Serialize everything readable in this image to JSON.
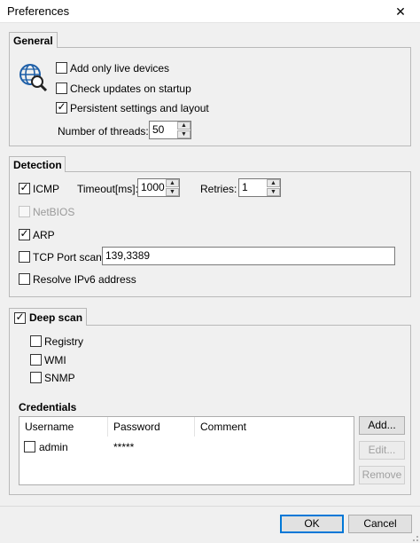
{
  "window": {
    "title": "Preferences",
    "close_glyph": "✕"
  },
  "general": {
    "tab_label": "General",
    "icon": "globe-search-icon",
    "options": [
      {
        "label": "Add only live devices",
        "checked": false
      },
      {
        "label": "Check updates on startup",
        "checked": false
      },
      {
        "label": "Persistent settings and layout",
        "checked": true
      }
    ],
    "threads_label": "Number of threads:",
    "threads_value": "50"
  },
  "detection": {
    "tab_label": "Detection",
    "icmp": {
      "label": "ICMP",
      "checked": true
    },
    "timeout_label": "Timeout[ms]:",
    "timeout_value": "1000",
    "retries_label": "Retries:",
    "retries_value": "1",
    "netbios": {
      "label": "NetBIOS",
      "checked": false,
      "disabled": true
    },
    "arp": {
      "label": "ARP",
      "checked": true
    },
    "tcp": {
      "label": "TCP Port scan",
      "checked": false
    },
    "tcp_ports": "139,3389",
    "ipv6": {
      "label": "Resolve IPv6 address",
      "checked": false
    }
  },
  "deep_scan": {
    "tab_label": "Deep scan",
    "checked": true,
    "registry": {
      "label": "Registry",
      "checked": false
    },
    "wmi": {
      "label": "WMI",
      "checked": false
    },
    "snmp": {
      "label": "SNMP",
      "checked": false
    },
    "credentials_label": "Credentials",
    "columns": [
      "Username",
      "Password",
      "Comment"
    ],
    "rows": [
      {
        "username": "admin",
        "password": "*****",
        "comment": "",
        "checked": false
      }
    ],
    "buttons": {
      "add": "Add...",
      "edit": "Edit...",
      "remove": "Remove"
    }
  },
  "footer": {
    "ok": "OK",
    "cancel": "Cancel"
  },
  "colors": {
    "accent": "#0078d7",
    "icon": "#1e5fa8"
  }
}
